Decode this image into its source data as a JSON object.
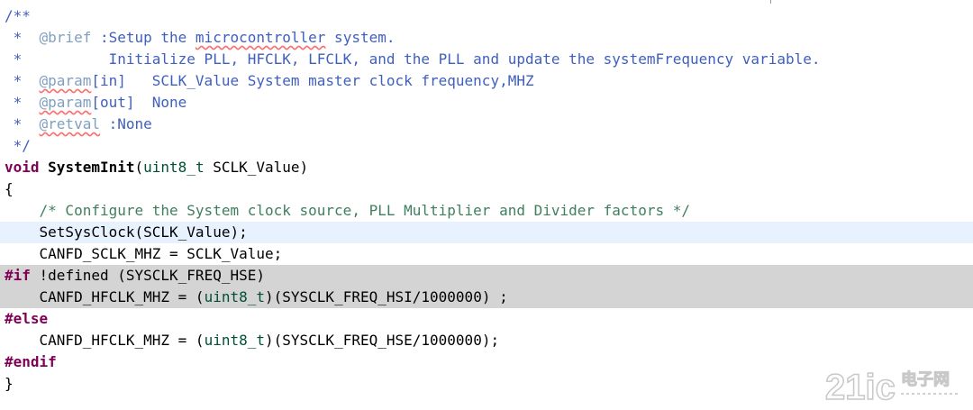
{
  "editor": {
    "lines": [
      {
        "segments": [
          {
            "text": "/**",
            "cls": "c-doc"
          }
        ]
      },
      {
        "segments": [
          {
            "text": " *  ",
            "cls": "c-doc"
          },
          {
            "text": "@brief",
            "cls": "c-tag"
          },
          {
            "text": " :Setup the ",
            "cls": "c-doc"
          },
          {
            "text": "microcontroller",
            "cls": "c-doc spell"
          },
          {
            "text": " system.",
            "cls": "c-doc"
          }
        ]
      },
      {
        "segments": [
          {
            "text": " *          Initialize PLL, HFCLK, LFCLK, and the PLL and update the systemFrequency variable.",
            "cls": "c-doc"
          }
        ]
      },
      {
        "segments": [
          {
            "text": " *  ",
            "cls": "c-doc"
          },
          {
            "text": "@param",
            "cls": "c-tag spell"
          },
          {
            "text": "[in]   SCLK_Value System master clock frequency,MHZ",
            "cls": "c-doc"
          }
        ]
      },
      {
        "segments": [
          {
            "text": " *  ",
            "cls": "c-doc"
          },
          {
            "text": "@param",
            "cls": "c-tag spell"
          },
          {
            "text": "[out]  None",
            "cls": "c-doc"
          }
        ]
      },
      {
        "segments": [
          {
            "text": " *  ",
            "cls": "c-doc"
          },
          {
            "text": "@retval",
            "cls": "c-tag spell"
          },
          {
            "text": " :None",
            "cls": "c-doc"
          }
        ]
      },
      {
        "segments": [
          {
            "text": " */",
            "cls": "c-doc"
          }
        ]
      },
      {
        "segments": [
          {
            "text": "void",
            "cls": "c-keyword"
          },
          {
            "text": " ",
            "cls": "c-plain"
          },
          {
            "text": "SystemInit",
            "cls": "c-func"
          },
          {
            "text": "(",
            "cls": "c-plain"
          },
          {
            "text": "uint8_t",
            "cls": "c-type"
          },
          {
            "text": " SCLK_Value)",
            "cls": "c-plain"
          }
        ]
      },
      {
        "segments": [
          {
            "text": "{",
            "cls": "c-plain"
          }
        ]
      },
      {
        "segments": [
          {
            "text": "    /* Configure the System clock source, PLL Multiplier and Divider factors */",
            "cls": "c-comment"
          }
        ]
      },
      {
        "segments": [
          {
            "text": "    SetSysClock(SCLK_Value);",
            "cls": "c-plain"
          }
        ],
        "highlight": "current"
      },
      {
        "segments": [
          {
            "text": "    CANFD_SCLK_MHZ = SCLK_Value;",
            "cls": "c-plain"
          }
        ]
      },
      {
        "segments": [
          {
            "text": "#if",
            "cls": "c-keyword"
          },
          {
            "text": " !defined (SYSCLK_FREQ_HSE)",
            "cls": "c-plain"
          }
        ],
        "highlight": "inactive"
      },
      {
        "segments": [
          {
            "text": "    CANFD_HFCLK_MHZ = (",
            "cls": "c-plain"
          },
          {
            "text": "uint8_t",
            "cls": "c-type"
          },
          {
            "text": ")(SYSCLK_FREQ_HSI/1000000) ;",
            "cls": "c-plain"
          }
        ],
        "highlight": "inactive"
      },
      {
        "segments": [
          {
            "text": "#else",
            "cls": "c-keyword"
          }
        ]
      },
      {
        "segments": [
          {
            "text": "    CANFD_HFCLK_MHZ = (",
            "cls": "c-plain"
          },
          {
            "text": "uint8_t",
            "cls": "c-type"
          },
          {
            "text": ")(SYSCLK_FREQ_HSE/1000000);",
            "cls": "c-plain"
          }
        ]
      },
      {
        "segments": [
          {
            "text": "#endif",
            "cls": "c-keyword"
          }
        ]
      },
      {
        "segments": [
          {
            "text": "}",
            "cls": "c-plain"
          }
        ]
      }
    ]
  },
  "watermark": {
    "brand_number": "21ic",
    "brand_text": "电子网"
  },
  "colors": {
    "comment": "#3f7f5f",
    "javadoc": "#3f5fbf",
    "doc_tag": "#7f9fbf",
    "keyword": "#7f0055",
    "type": "#005032",
    "current_line": "#e8f2fe",
    "inactive_code": "#d4d4d4"
  }
}
